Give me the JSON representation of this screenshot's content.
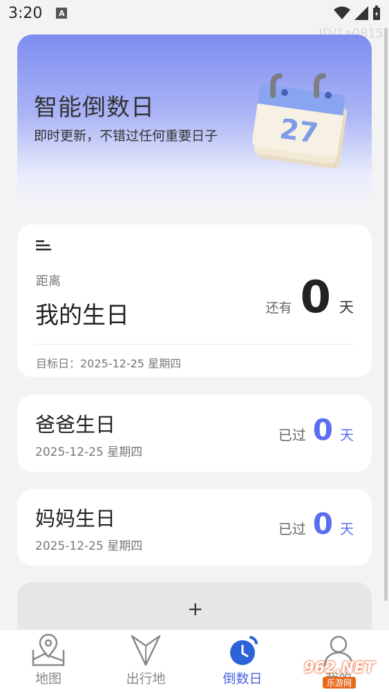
{
  "status": {
    "time": "3:20",
    "indicator": "A",
    "watermark": "ID/1a0815"
  },
  "banner": {
    "title": "智能倒数日",
    "subtitle": "即时更新，不错过任何重要日子",
    "calendar_number": "27"
  },
  "main_card": {
    "label": "距离",
    "name": "我的生日",
    "remain_text": "还有",
    "days": "0",
    "unit": "天",
    "target": "目标日：2025-12-25 星期四"
  },
  "events": [
    {
      "name": "爸爸生日",
      "date": "2025-12-25 星期四",
      "status": "已过",
      "days": "0",
      "unit": "天"
    },
    {
      "name": "妈妈生日",
      "date": "2025-12-25 星期四",
      "status": "已过",
      "days": "0",
      "unit": "天"
    }
  ],
  "add_card": {
    "plus": "+"
  },
  "nav": {
    "items": [
      {
        "label": "地图",
        "icon": "map-pin-icon"
      },
      {
        "label": "出行地",
        "icon": "destination-icon"
      },
      {
        "label": "倒数日",
        "icon": "alarm-clock-icon"
      },
      {
        "label": "我的",
        "icon": "user-icon"
      }
    ],
    "active_color": "#4a63e0"
  },
  "badge": {
    "top": "962.NET",
    "bottom": "乐游网"
  },
  "colors": {
    "accent": "#5b6ef0",
    "banner_top": "#7d8df0"
  }
}
